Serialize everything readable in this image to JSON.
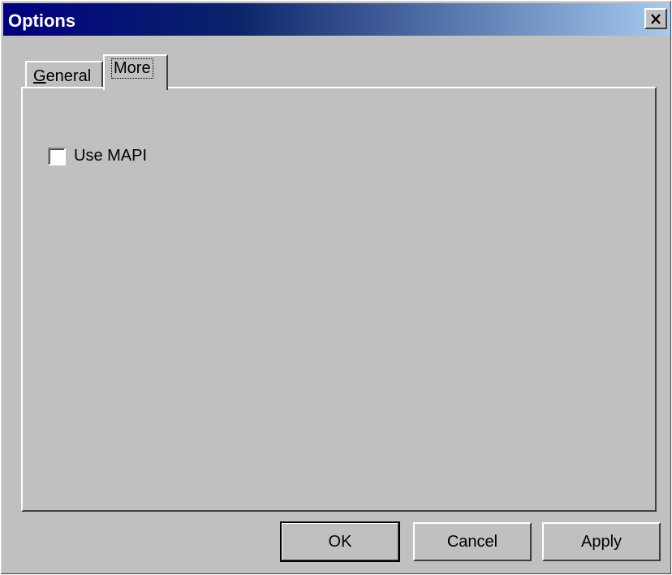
{
  "window": {
    "title": "Options",
    "close_label": "×"
  },
  "tabs": [
    {
      "label_first": "G",
      "label_rest": "eneral",
      "selected": false
    },
    {
      "label": "More",
      "selected": true
    }
  ],
  "panel": {
    "checkbox": {
      "label": "Use MAPI",
      "checked": false
    }
  },
  "buttons": {
    "ok": "OK",
    "cancel": "Cancel",
    "apply": "Apply"
  }
}
